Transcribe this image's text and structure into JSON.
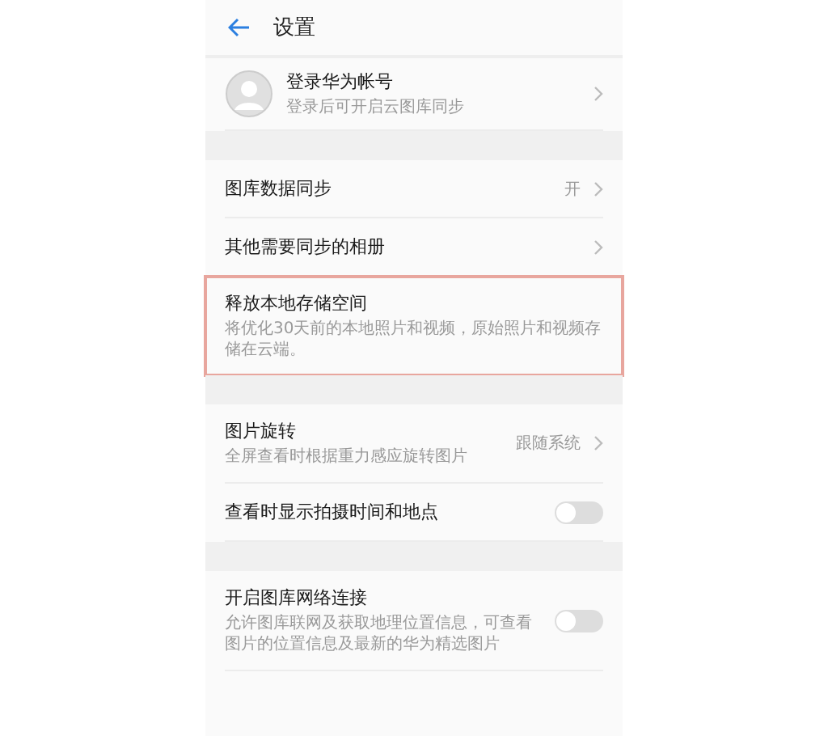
{
  "header": {
    "title": "设置"
  },
  "sections": [
    {
      "items": [
        {
          "kind": "account",
          "title": "登录华为帐号",
          "subtitle": "登录后可开启云图库同步",
          "highlighted": false
        }
      ]
    },
    {
      "items": [
        {
          "kind": "link",
          "title": "图库数据同步",
          "value": "开",
          "highlighted": false
        },
        {
          "kind": "link",
          "title": "其他需要同步的相册",
          "highlighted": false
        },
        {
          "kind": "plain",
          "title": "释放本地存储空间",
          "subtitle": "将优化30天前的本地照片和视频，原始照片和视频存储在云端。",
          "highlighted": true
        }
      ]
    },
    {
      "items": [
        {
          "kind": "link",
          "title": "图片旋转",
          "subtitle": "全屏查看时根据重力感应旋转图片",
          "value": "跟随系统",
          "highlighted": false
        },
        {
          "kind": "toggle",
          "title": "查看时显示拍摄时间和地点",
          "on": false,
          "highlighted": false
        }
      ]
    },
    {
      "items": [
        {
          "kind": "toggle",
          "title": "开启图库网络连接",
          "subtitle": "允许图库联网及获取地理位置信息，可查看图片的位置信息及最新的华为精选图片",
          "on": false,
          "highlighted": false
        }
      ]
    }
  ]
}
